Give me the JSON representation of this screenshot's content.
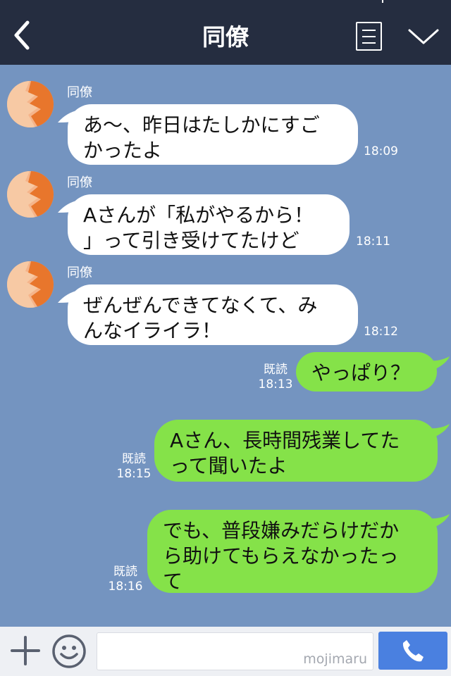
{
  "header": {
    "title": "同僚",
    "back_icon": "chevron-left-icon",
    "menu_icon": "notes-menu-icon",
    "collapse_icon": "chevron-down-icon",
    "background": "#252d40"
  },
  "chat": {
    "background": "#7494c0",
    "messages": [
      {
        "side": "incoming",
        "sender": "同僚",
        "text": "あ〜、昨日はたしかにすご\nかったよ",
        "time": "18:09"
      },
      {
        "side": "incoming",
        "sender": "同僚",
        "text": "Aさんが「私がやるから！\n」って引き受けてたけど",
        "time": "18:11"
      },
      {
        "side": "incoming",
        "sender": "同僚",
        "text": "ぜんぜんできてなくて、み\nんなイライラ！",
        "time": "18:12"
      },
      {
        "side": "outgoing",
        "text": "やっぱり？",
        "read": "既読",
        "time": "18:13"
      },
      {
        "side": "outgoing",
        "text": "Aさん、長時間残業してた\nって聞いたよ",
        "read": "既読",
        "time": "18:15"
      },
      {
        "side": "outgoing",
        "text": "でも、普段嫌みだらけだか\nら助けてもらえなかったっ\nて",
        "read": "既読",
        "time": "18:16"
      }
    ],
    "incoming_bubble_color": "#ffffff",
    "outgoing_bubble_color": "#85e249"
  },
  "input_bar": {
    "add_icon": "plus-icon",
    "sticker_icon": "smiley-icon",
    "watermark": "mojimaru",
    "call_icon": "phone-icon",
    "call_color": "#4a80e0"
  }
}
